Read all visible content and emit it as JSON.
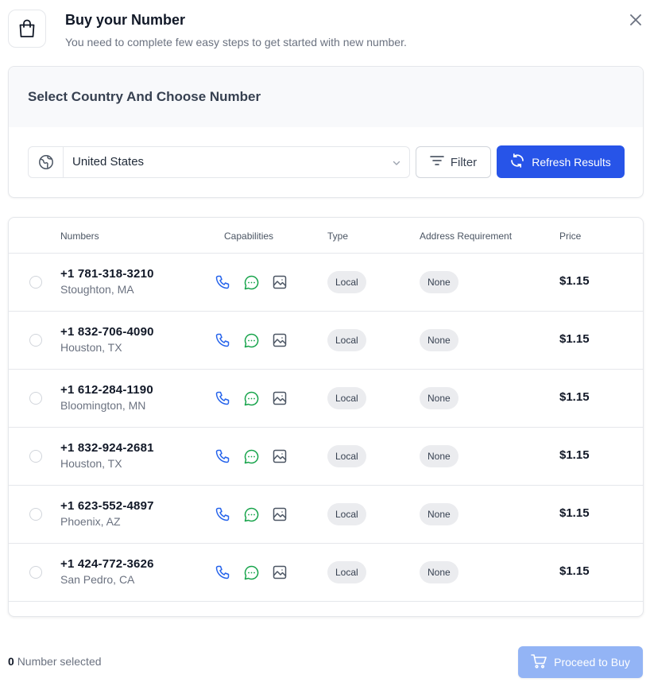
{
  "header": {
    "title": "Buy your Number",
    "subtitle": "You need to complete few easy steps to get started with new number."
  },
  "selection": {
    "heading": "Select Country And Choose Number",
    "country": "United States",
    "filter_label": "Filter",
    "refresh_label": "Refresh Results"
  },
  "table": {
    "columns": [
      "Numbers",
      "Capabilities",
      "Type",
      "Address Requirement",
      "Price"
    ],
    "rows": [
      {
        "number": "+1 781-318-3210",
        "location": "Stoughton, MA",
        "type": "Local",
        "address": "None",
        "price": "$1.15"
      },
      {
        "number": "+1 832-706-4090",
        "location": "Houston, TX",
        "type": "Local",
        "address": "None",
        "price": "$1.15"
      },
      {
        "number": "+1 612-284-1190",
        "location": "Bloomington, MN",
        "type": "Local",
        "address": "None",
        "price": "$1.15"
      },
      {
        "number": "+1 832-924-2681",
        "location": "Houston, TX",
        "type": "Local",
        "address": "None",
        "price": "$1.15"
      },
      {
        "number": "+1 623-552-4897",
        "location": "Phoenix, AZ",
        "type": "Local",
        "address": "None",
        "price": "$1.15"
      },
      {
        "number": "+1 424-772-3626",
        "location": "San Pedro, CA",
        "type": "Local",
        "address": "None",
        "price": "$1.15"
      }
    ],
    "capability_icons": [
      "phone-icon",
      "sms-icon",
      "mms-icon"
    ]
  },
  "footer": {
    "selected_count": "0",
    "selected_label": "Number selected",
    "proceed_label": "Proceed to Buy"
  },
  "colors": {
    "primary": "#2754e8",
    "primary_disabled": "#93b4f5",
    "voice_icon": "#2563eb",
    "sms_icon": "#16a34a",
    "mms_icon": "#4b5563"
  }
}
